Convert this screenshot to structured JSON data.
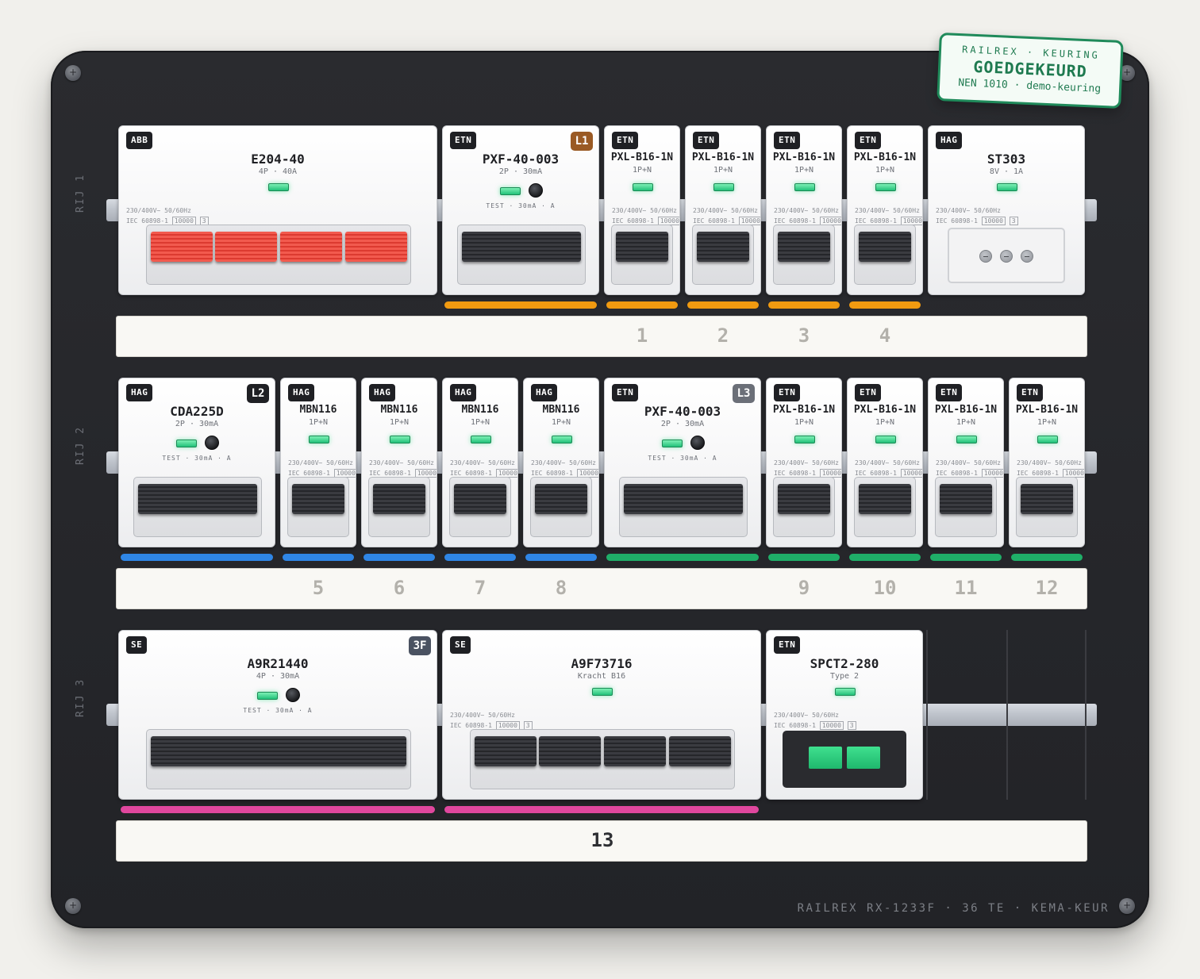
{
  "colors": {
    "group_orange": "#f19a10",
    "group_blue": "#2f86e6",
    "group_green": "#1fae68",
    "group_magenta": "#e0479e",
    "phase_l1": "#9a5a24",
    "phase_l2": "#1f2024",
    "phase_l3": "#6b6f78",
    "phase_3f": "#4a5261",
    "stamp_green": "#1f8a5a"
  },
  "stamp": {
    "line1": "RAILREX · KEURING",
    "line2": "GOEDGEKEURD",
    "line3": "NEN 1010 · demo-keuring"
  },
  "footer": "RAILREX RX-1233F · 36 TE · KEMA-KEUR",
  "spec_text": {
    "line1": "230/400V~ 50/60Hz",
    "iec": "IEC 60898-1",
    "ka": "10000",
    "cls": "3"
  },
  "rows": [
    {
      "label": "RIJ 1",
      "modules": [
        {
          "brand": "ABB",
          "name": "E204-40",
          "spec": "4P · 40A"
        },
        {
          "brand": "ETN",
          "name": "PXF-40-003",
          "spec": "2P · 30mA",
          "phase": "L1",
          "test": "TEST · 30mA · A"
        },
        {
          "brand": "ETN",
          "name": "PXL-B16-1N",
          "spec": "1P+N"
        },
        {
          "brand": "ETN",
          "name": "PXL-B16-1N",
          "spec": "1P+N"
        },
        {
          "brand": "ETN",
          "name": "PXL-B16-1N",
          "spec": "1P+N"
        },
        {
          "brand": "ETN",
          "name": "PXL-B16-1N",
          "spec": "1P+N"
        },
        {
          "brand": "HAG",
          "name": "ST303",
          "spec": "8V · 1A"
        }
      ],
      "circuits": [
        "1",
        "2",
        "3",
        "4"
      ]
    },
    {
      "label": "RIJ 2",
      "modules": [
        {
          "brand": "HAG",
          "name": "CDA225D",
          "spec": "2P · 30mA",
          "phase": "L2",
          "test": "TEST · 30mA · A"
        },
        {
          "brand": "HAG",
          "name": "MBN116",
          "spec": "1P+N"
        },
        {
          "brand": "HAG",
          "name": "MBN116",
          "spec": "1P+N"
        },
        {
          "brand": "HAG",
          "name": "MBN116",
          "spec": "1P+N"
        },
        {
          "brand": "HAG",
          "name": "MBN116",
          "spec": "1P+N"
        },
        {
          "brand": "ETN",
          "name": "PXF-40-003",
          "spec": "2P · 30mA",
          "phase": "L3",
          "test": "TEST · 30mA · A"
        },
        {
          "brand": "ETN",
          "name": "PXL-B16-1N",
          "spec": "1P+N"
        },
        {
          "brand": "ETN",
          "name": "PXL-B16-1N",
          "spec": "1P+N"
        },
        {
          "brand": "ETN",
          "name": "PXL-B16-1N",
          "spec": "1P+N"
        },
        {
          "brand": "ETN",
          "name": "PXL-B16-1N",
          "spec": "1P+N"
        }
      ],
      "circuits": [
        "5",
        "6",
        "7",
        "8",
        "9",
        "10",
        "11",
        "12"
      ]
    },
    {
      "label": "RIJ 3",
      "modules": [
        {
          "brand": "SE",
          "name": "A9R21440",
          "spec": "4P · 30mA",
          "phase": "3F",
          "test": "TEST · 30mA · A"
        },
        {
          "brand": "SE",
          "name": "A9F73716",
          "spec": "Kracht B16"
        },
        {
          "brand": "ETN",
          "name": "SPCT2-280",
          "spec": "Type 2"
        }
      ],
      "circuits": [
        "13"
      ]
    }
  ]
}
